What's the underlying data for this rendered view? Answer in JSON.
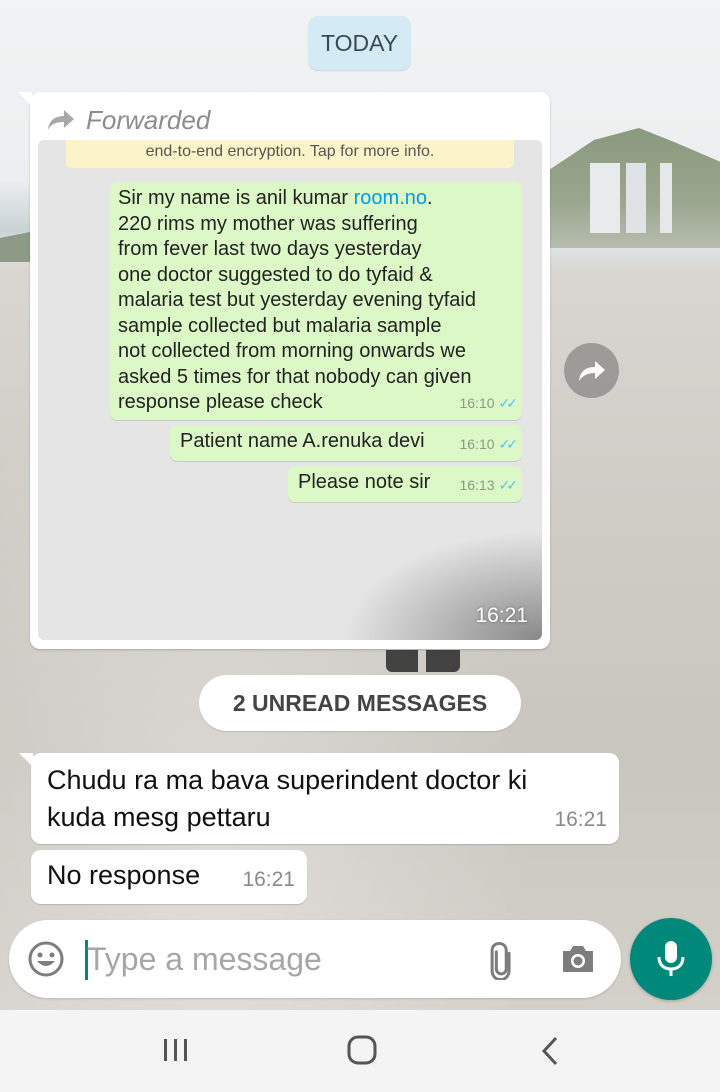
{
  "chat": {
    "date_chip": "TODAY",
    "forwarded_message": {
      "forwarded_label": "Forwarded",
      "image": {
        "encryption_notice": "end-to-end encryption. Tap for more info.",
        "messages": [
          {
            "text_before_link": "Sir my name is anil kumar ",
            "link": "room.no",
            "text_after_link": ".\n220 rims my mother was suffering\nfrom fever last two days yesterday\none doctor suggested to do tyfaid &\nmalaria test but yesterday evening tyfaid\nsample collected but malaria sample\nnot collected from morning onwards we\nasked 5 times for that nobody can given\nresponse please check",
            "time": "16:10"
          },
          {
            "text": "Patient name A.renuka devi",
            "time": "16:10"
          },
          {
            "text": "Please note sir",
            "time": "16:13"
          }
        ]
      },
      "time": "16:21"
    },
    "unread_banner": "2 UNREAD MESSAGES",
    "incoming_messages": [
      {
        "text": "Chudu ra ma bava superindent doctor ki\nkuda mesg pettaru",
        "time": "16:21"
      },
      {
        "text": "No response",
        "time": "16:21"
      }
    ]
  },
  "composer": {
    "placeholder": "Type a message",
    "value": ""
  },
  "icons": {
    "forwarded": "forward-arrow-icon",
    "forward_button": "share-forward-icon",
    "emoji": "emoji-icon",
    "attach": "paperclip-icon",
    "camera": "camera-icon",
    "mic": "microphone-icon",
    "nav_recents": "recents-icon",
    "nav_home": "home-icon",
    "nav_back": "back-icon"
  },
  "colors": {
    "accent": "#00897b",
    "outgoing_bubble": "#dcf8c6",
    "date_chip": "#d4eaf4",
    "read_ticks": "#4fc3f7"
  }
}
